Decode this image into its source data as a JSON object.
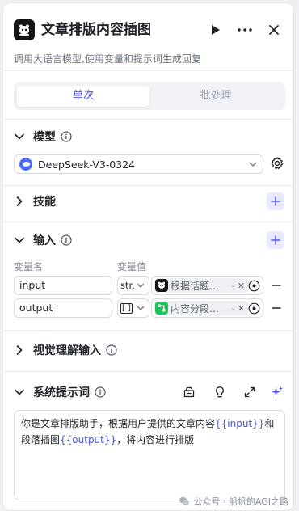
{
  "header": {
    "title": "文章排版内容插图",
    "description": "调用大语言模型,使用变量和提示词生成回复"
  },
  "mode_tabs": [
    {
      "label": "单次",
      "active": true
    },
    {
      "label": "批处理",
      "active": false
    }
  ],
  "sections": {
    "model": {
      "title": "模型",
      "selected": "DeepSeek-V3-0324"
    },
    "skills": {
      "title": "技能"
    },
    "input": {
      "title": "输入",
      "col_name": "变量名",
      "col_value": "变量值",
      "rows": [
        {
          "name": "input",
          "type": "str.",
          "ref": "根据话题…",
          "ref_dash": "-",
          "ref_icon": "coze-bot-icon"
        },
        {
          "name": "output",
          "type": "[ ]",
          "ref": "内容分段…",
          "ref_dash": "-",
          "ref_icon": "workflow-node-icon"
        }
      ]
    },
    "vision": {
      "title": "视觉理解输入"
    },
    "system_prompt": {
      "title": "系统提示词",
      "text_part1": "你是文章排版助手，根据用户提供的文章内容",
      "var1": "{{input}}",
      "text_part2": "和段落插图",
      "var2": "{{output}}",
      "text_part3": "，将内容进行排版"
    }
  },
  "watermark": {
    "text": "公众号 · 船帆的AGI之路"
  },
  "colors": {
    "accent": "#4d53e8",
    "accent_bg": "#e8e9ff",
    "deepseek_blue": "#4d6bfe",
    "workflow_green": "#20c05c"
  }
}
